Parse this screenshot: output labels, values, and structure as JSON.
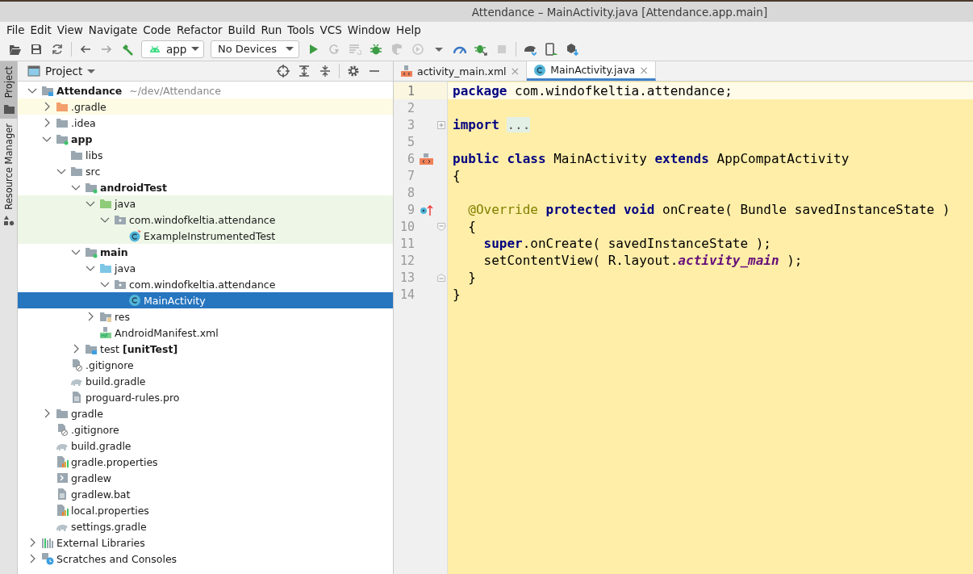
{
  "window": {
    "title": "Attendance – MainActivity.java [Attendance.app.main]"
  },
  "menu": [
    {
      "label": "File"
    },
    {
      "label": "Edit"
    },
    {
      "label": "View"
    },
    {
      "label": "Navigate"
    },
    {
      "label": "Code"
    },
    {
      "label": "Refactor"
    },
    {
      "label": "Build"
    },
    {
      "label": "Run"
    },
    {
      "label": "Tools"
    },
    {
      "label": "VCS"
    },
    {
      "label": "Window"
    },
    {
      "label": "Help"
    }
  ],
  "toolbar": [
    {
      "kind": "open",
      "disabled": false
    },
    {
      "kind": "save",
      "disabled": false
    },
    {
      "kind": "sync",
      "disabled": false
    },
    {
      "kind": "sep"
    },
    {
      "kind": "back",
      "disabled": false
    },
    {
      "kind": "forward",
      "disabled": true
    },
    {
      "kind": "hammer",
      "disabled": false
    },
    {
      "kind": "config",
      "label": "app"
    },
    {
      "kind": "devices",
      "label": "No Devices"
    },
    {
      "kind": "run",
      "disabled": false
    },
    {
      "kind": "apply",
      "disabled": true
    },
    {
      "kind": "applycode",
      "disabled": true
    },
    {
      "kind": "debug",
      "disabled": false
    },
    {
      "kind": "profile",
      "disabled": true
    },
    {
      "kind": "attach",
      "disabled": true
    },
    {
      "kind": "caret",
      "disabled": false
    },
    {
      "kind": "gauge",
      "disabled": false
    },
    {
      "kind": "attachdebug",
      "disabled": false
    },
    {
      "kind": "stop",
      "disabled": true
    },
    {
      "kind": "sep"
    },
    {
      "kind": "gradlesync",
      "disabled": false
    },
    {
      "kind": "avd",
      "disabled": false
    },
    {
      "kind": "sdk",
      "disabled": false
    }
  ],
  "side_tabs": [
    {
      "label": "Project",
      "selected": true
    },
    {
      "label": "Resource Manager",
      "selected": false
    }
  ],
  "project_panel": {
    "title": "Project",
    "tree": [
      {
        "label": "Attendance",
        "path": "~/dev/Attendance",
        "kind": "module-root",
        "bold": true,
        "expanded": true,
        "selected": false,
        "children": [
          {
            "label": ".gradle",
            "kind": "folder-excluded",
            "excluded": true,
            "expanded": false,
            "selected": false
          },
          {
            "label": ".idea",
            "kind": "folder",
            "expanded": false,
            "selected": false
          },
          {
            "label": "app",
            "kind": "module",
            "bold": true,
            "expanded": true,
            "selected": false,
            "children": [
              {
                "label": "libs",
                "kind": "folder",
                "selected": false
              },
              {
                "label": "src",
                "kind": "folder",
                "expanded": true,
                "selected": false,
                "children": [
                  {
                    "label": "androidTest",
                    "kind": "module",
                    "bold": true,
                    "expanded": true,
                    "selected": false,
                    "children": [
                      {
                        "label": "java",
                        "kind": "folder-test",
                        "test_scope": true,
                        "expanded": true,
                        "selected": false,
                        "children": [
                          {
                            "label": "com.windofkeltia.attendance",
                            "kind": "package",
                            "test_scope": true,
                            "expanded": true,
                            "selected": false,
                            "children": [
                              {
                                "label": "ExampleInstrumentedTest",
                                "kind": "test-class",
                                "test_scope": true,
                                "selected": false
                              }
                            ]
                          }
                        ]
                      }
                    ]
                  },
                  {
                    "label": "main",
                    "kind": "module",
                    "bold": true,
                    "expanded": true,
                    "selected": false,
                    "children": [
                      {
                        "label": "java",
                        "kind": "folder-source",
                        "expanded": true,
                        "selected": false,
                        "children": [
                          {
                            "label": "com.windofkeltia.attendance",
                            "kind": "package",
                            "expanded": true,
                            "selected": false,
                            "children": [
                              {
                                "label": "MainActivity",
                                "kind": "class",
                                "selected": true
                              }
                            ]
                          }
                        ]
                      },
                      {
                        "label": "res",
                        "kind": "folder-res",
                        "expanded": false,
                        "selected": false
                      },
                      {
                        "label": "AndroidManifest.xml",
                        "kind": "manifest",
                        "selected": false
                      }
                    ]
                  },
                  {
                    "label": "test **[unitTest]**",
                    "kind": "folder-unittest",
                    "expanded": false,
                    "selected": false
                  }
                ]
              },
              {
                "label": ".gitignore",
                "kind": "gitignore",
                "selected": false
              },
              {
                "label": "build.gradle",
                "kind": "gradle",
                "selected": false
              },
              {
                "label": "proguard-rules.pro",
                "kind": "text-file",
                "selected": false
              }
            ]
          },
          {
            "label": "gradle",
            "kind": "folder",
            "expanded": false,
            "selected": false
          },
          {
            "label": ".gitignore",
            "kind": "gitignore",
            "selected": false
          },
          {
            "label": "build.gradle",
            "kind": "gradle",
            "selected": false
          },
          {
            "label": "gradle.properties",
            "kind": "properties",
            "selected": false
          },
          {
            "label": "gradlew",
            "kind": "script",
            "selected": false
          },
          {
            "label": "gradlew.bat",
            "kind": "text-file",
            "selected": false
          },
          {
            "label": "local.properties",
            "kind": "properties",
            "selected": false
          },
          {
            "label": "settings.gradle",
            "kind": "gradle",
            "selected": false
          }
        ]
      },
      {
        "label": "External Libraries",
        "kind": "libraries",
        "expanded": false,
        "selected": false
      },
      {
        "label": "Scratches and Consoles",
        "kind": "scratches",
        "expanded": false,
        "selected": false
      }
    ]
  },
  "editor": {
    "tabs": [
      {
        "label": "activity_main.xml",
        "kind": "xml",
        "close": "×",
        "selected": false
      },
      {
        "label": "MainActivity.java",
        "kind": "class",
        "close": "×",
        "selected": true
      }
    ],
    "lines": [
      {
        "number": "1",
        "current": true,
        "tokens": [
          {
            "t": "package",
            "kind": "kw"
          },
          {
            "t": " com.windofkeltia.attendance;",
            "kind": "plain"
          }
        ]
      },
      {
        "number": "2",
        "current": false
      },
      {
        "number": "3",
        "current": false,
        "fold": {
          "kind": "collapsed"
        },
        "tokens": [
          {
            "t": "import",
            "kind": "kw"
          },
          {
            "t": "...",
            "kind": "folded"
          }
        ]
      },
      {
        "number": "5",
        "current": false
      },
      {
        "number": "6",
        "current": false,
        "marker": {
          "kind": "layout"
        },
        "tokens": [
          {
            "t": "public class",
            "kind": "kw"
          },
          {
            "t": " MainActivity ",
            "kind": "plain"
          },
          {
            "t": "extends",
            "kind": "kw"
          },
          {
            "t": " AppCompatActivity",
            "kind": "plain"
          }
        ]
      },
      {
        "number": "7",
        "current": false,
        "tokens": [
          {
            "t": "{",
            "kind": "plain"
          }
        ]
      },
      {
        "number": "8",
        "current": false
      },
      {
        "number": "9",
        "current": false,
        "marker": {
          "kind": "override"
        },
        "tokens": [
          {
            "t": "  @Override",
            "kind": "ann"
          },
          {
            "t": " protected void",
            "kind": "kw"
          },
          {
            "t": " onCreate( Bundle savedInstanceState )",
            "kind": "plain"
          }
        ]
      },
      {
        "number": "10",
        "current": false,
        "fold": {
          "kind": "start"
        },
        "tokens": [
          {
            "t": "  {",
            "kind": "plain"
          }
        ]
      },
      {
        "number": "11",
        "current": false,
        "tokens": [
          {
            "t": "    super",
            "kind": "kw"
          },
          {
            "t": ".onCreate( savedInstanceState );",
            "kind": "plain"
          }
        ]
      },
      {
        "number": "12",
        "current": false,
        "tokens": [
          {
            "t": "    setContentView( R.layout.",
            "kind": "plain"
          },
          {
            "t": "activity_main",
            "kind": "field"
          },
          {
            "t": " );",
            "kind": "plain"
          }
        ]
      },
      {
        "number": "13",
        "current": false,
        "fold": {
          "kind": "end"
        },
        "tokens": [
          {
            "t": "  }",
            "kind": "plain"
          }
        ]
      },
      {
        "number": "14",
        "current": false,
        "tokens": [
          {
            "t": "}",
            "kind": "plain"
          }
        ]
      }
    ]
  }
}
